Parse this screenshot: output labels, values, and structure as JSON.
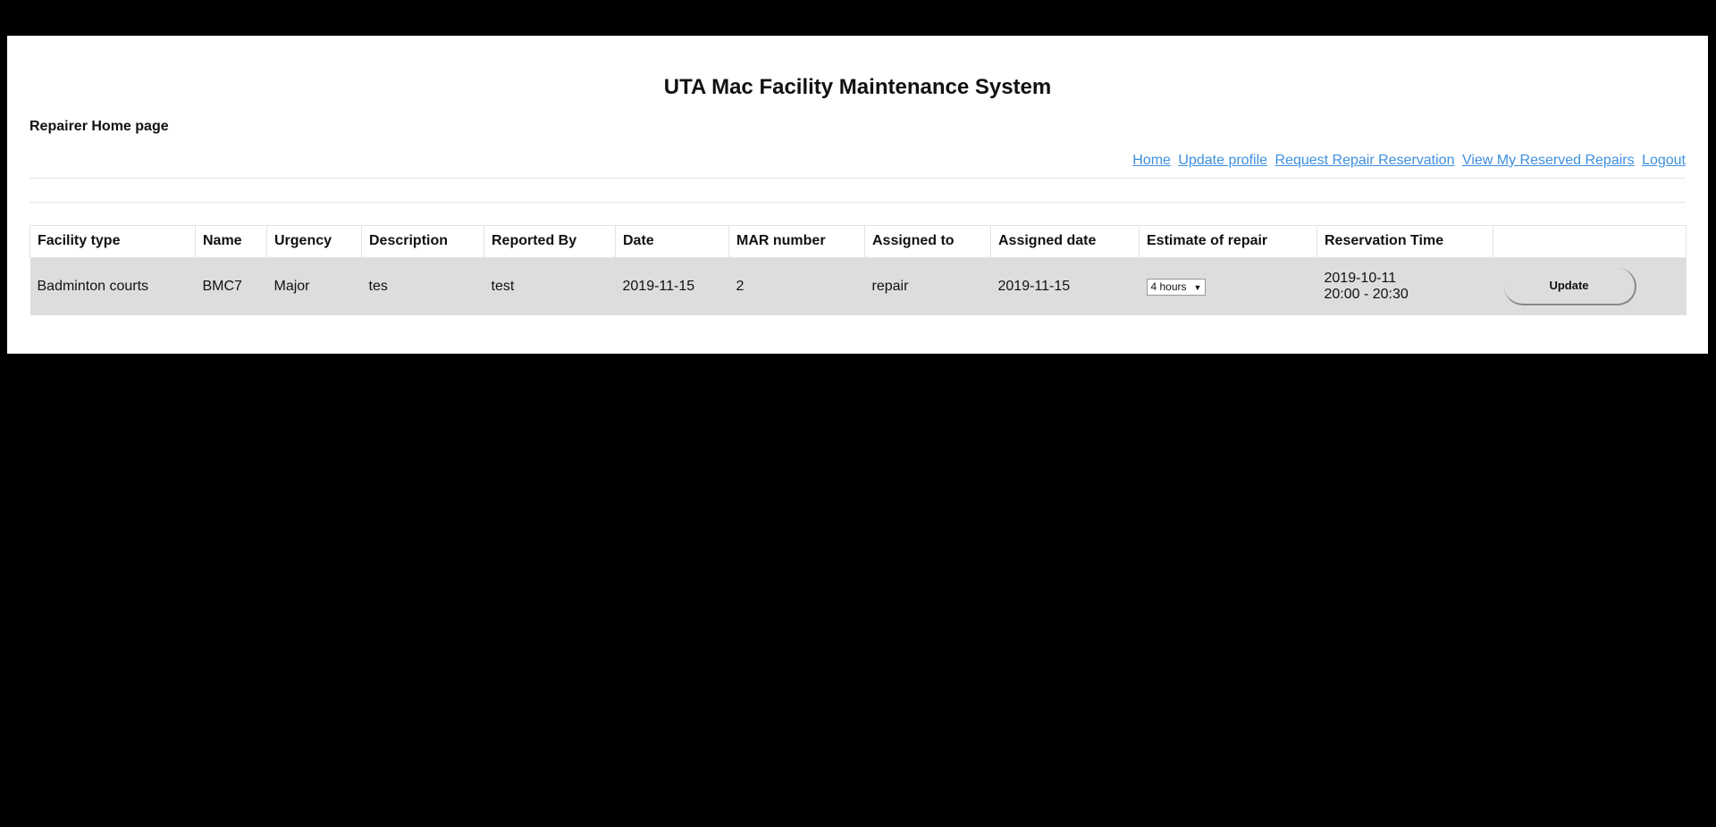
{
  "header": {
    "title": "UTA Mac Facility Maintenance System",
    "subtitle": "Repairer Home page"
  },
  "nav": {
    "items": [
      "Home",
      "Update profile",
      "Request Repair Reservation",
      "View My Reserved Repairs",
      "Logout"
    ],
    "link_color": "#3d8fe0"
  },
  "table": {
    "columns": [
      "Facility type",
      "Name",
      "Urgency",
      "Description",
      "Reported By",
      "Date",
      "MAR number",
      "Assigned to",
      "Assigned date",
      "Estimate of repair",
      "Reservation Time",
      ""
    ],
    "rows": [
      {
        "facility_type": "Badminton courts",
        "name": "BMC7",
        "urgency": "Major",
        "description": "tes",
        "reported_by": "test",
        "date": "2019-11-15",
        "mar_number": "2",
        "assigned_to": "repair",
        "assigned_date": "2019-11-15",
        "estimate": "4 hours",
        "reservation_date": "2019-10-11",
        "reservation_time": "20:00 - 20:30",
        "action_label": "Update"
      }
    ]
  }
}
